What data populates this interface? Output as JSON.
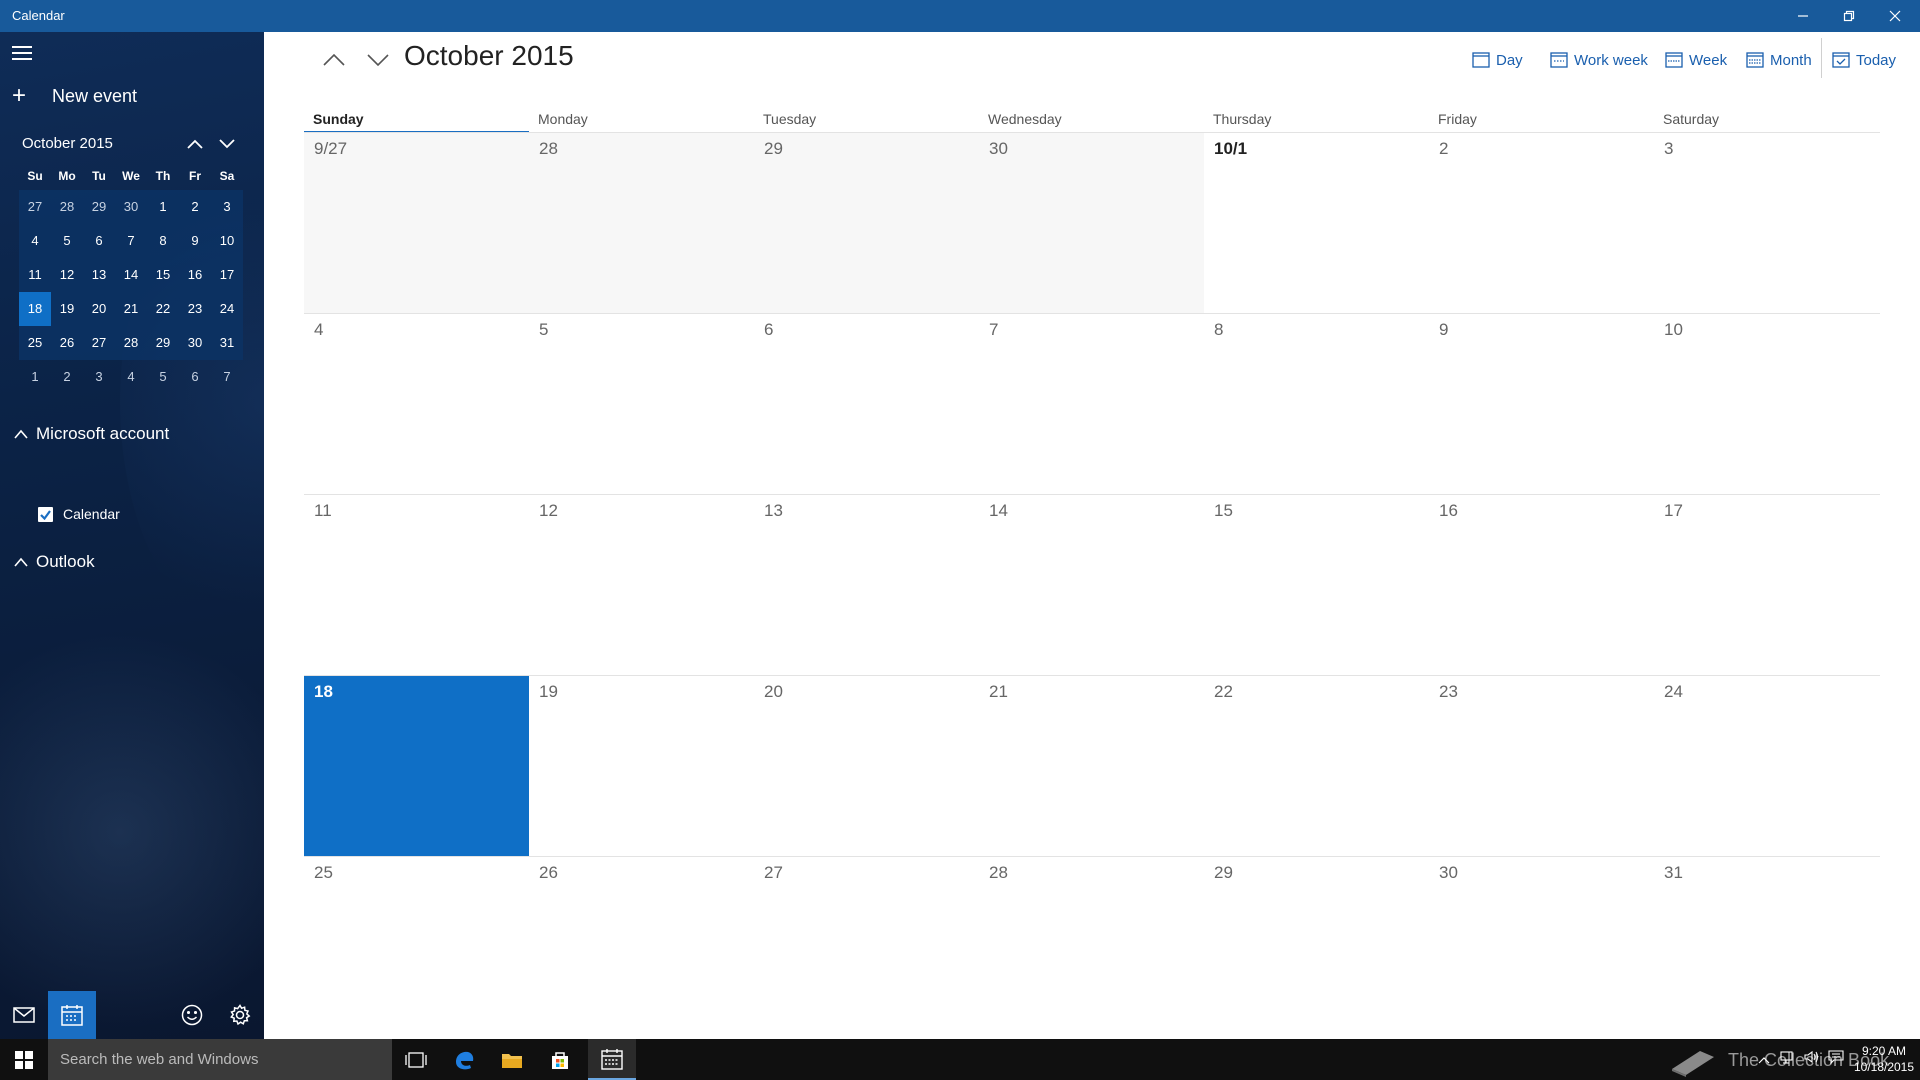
{
  "window": {
    "title": "Calendar",
    "controls": [
      "minimize",
      "restore",
      "close"
    ]
  },
  "sidebar": {
    "new_event_label": "New event",
    "mini_calendar": {
      "title": "October 2015",
      "days_of_week": [
        "Su",
        "Mo",
        "Tu",
        "We",
        "Th",
        "Fr",
        "Sa"
      ],
      "weeks": [
        [
          "27",
          "28",
          "29",
          "30",
          "1",
          "2",
          "3"
        ],
        [
          "4",
          "5",
          "6",
          "7",
          "8",
          "9",
          "10"
        ],
        [
          "11",
          "12",
          "13",
          "14",
          "15",
          "16",
          "17"
        ],
        [
          "18",
          "19",
          "20",
          "21",
          "22",
          "23",
          "24"
        ],
        [
          "25",
          "26",
          "27",
          "28",
          "29",
          "30",
          "31"
        ],
        [
          "1",
          "2",
          "3",
          "4",
          "5",
          "6",
          "7"
        ]
      ],
      "selected_day": "18"
    },
    "accounts": [
      {
        "name": "Microsoft account",
        "calendars": [
          {
            "name": "Calendar",
            "checked": true
          }
        ]
      },
      {
        "name": "Outlook",
        "calendars": []
      }
    ],
    "bottom_icons": [
      "mail-icon",
      "calendar-icon",
      "smiley-feedback-icon",
      "gear-icon"
    ]
  },
  "main": {
    "title": "October 2015",
    "views": {
      "day": "Day",
      "work_week": "Work week",
      "week": "Week",
      "month": "Month",
      "today": "Today"
    },
    "days_of_week": [
      "Sunday",
      "Monday",
      "Tuesday",
      "Wednesday",
      "Thursday",
      "Friday",
      "Saturday"
    ],
    "active_day_of_week": "Sunday",
    "weeks": [
      [
        "9/27",
        "28",
        "29",
        "30",
        "10/1",
        "2",
        "3"
      ],
      [
        "4",
        "5",
        "6",
        "7",
        "8",
        "9",
        "10"
      ],
      [
        "11",
        "12",
        "13",
        "14",
        "15",
        "16",
        "17"
      ],
      [
        "18",
        "19",
        "20",
        "21",
        "22",
        "23",
        "24"
      ],
      [
        "25",
        "26",
        "27",
        "28",
        "29",
        "30",
        "31"
      ]
    ],
    "today": "18"
  },
  "taskbar": {
    "search_placeholder": "Search the web and Windows",
    "watermark": "The Collection Book",
    "time": "9:20 AM",
    "date": "10/18/2015"
  },
  "colors": {
    "accent": "#0f6fc6",
    "titlebar": "#185a9b",
    "link": "#1a5fae"
  }
}
